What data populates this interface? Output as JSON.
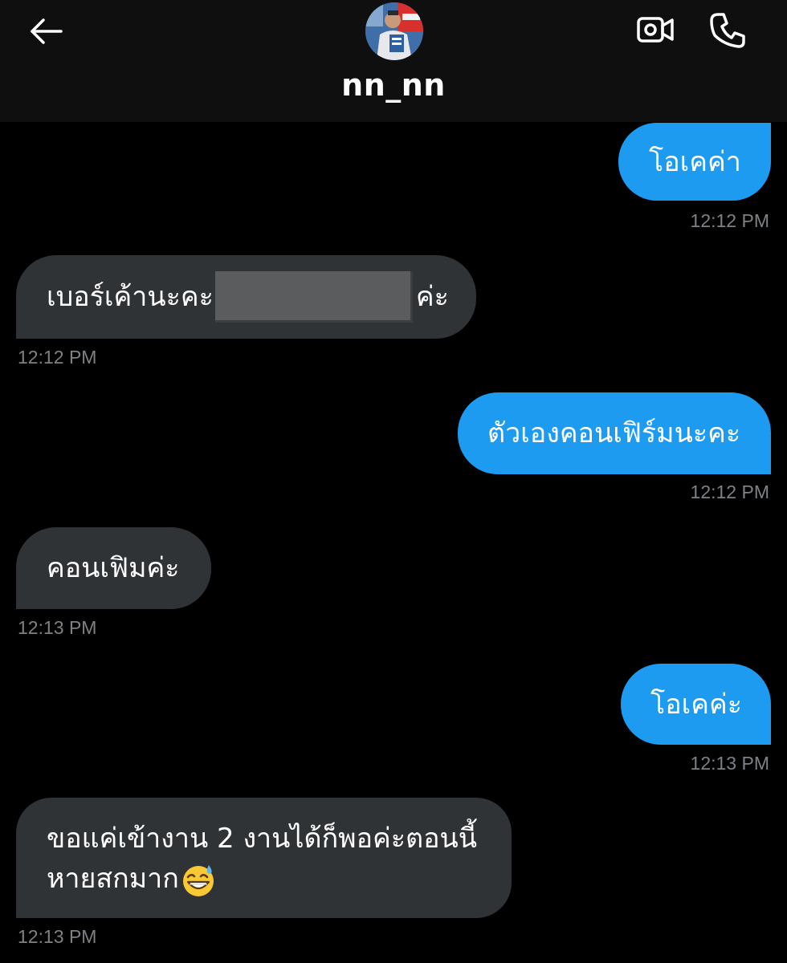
{
  "header": {
    "contact_name": "nn_nn",
    "back_icon": "arrow-left-icon",
    "video_icon": "video-call-icon",
    "phone_icon": "phone-icon"
  },
  "colors": {
    "sent_bubble": "#1d9bf0",
    "received_bubble": "#2f3336",
    "timestamp": "#7d8185",
    "background": "#000000"
  },
  "messages": [
    {
      "direction": "sent",
      "text": "โอเคค่า",
      "time": "12:12 PM"
    },
    {
      "direction": "received",
      "text_before": "เบอร์เค้านะคะ",
      "redacted": true,
      "text_after": "ค่ะ",
      "time": "12:12 PM"
    },
    {
      "direction": "sent",
      "text": "ตัวเองคอนเฟิร์มนะคะ",
      "time": "12:12 PM"
    },
    {
      "direction": "received",
      "text": "คอนเฟิมค่ะ",
      "time": "12:13 PM"
    },
    {
      "direction": "sent",
      "text": "โอเคค่ะ",
      "time": "12:13 PM"
    },
    {
      "direction": "received",
      "line1": "ขอแค่เข้างาน 2 งานได้ก็พอค่ะตอนนี้",
      "line2": "หายสกมาก",
      "emoji": "grinning-face-with-sweat-emoji",
      "time": "12:13 PM"
    }
  ]
}
